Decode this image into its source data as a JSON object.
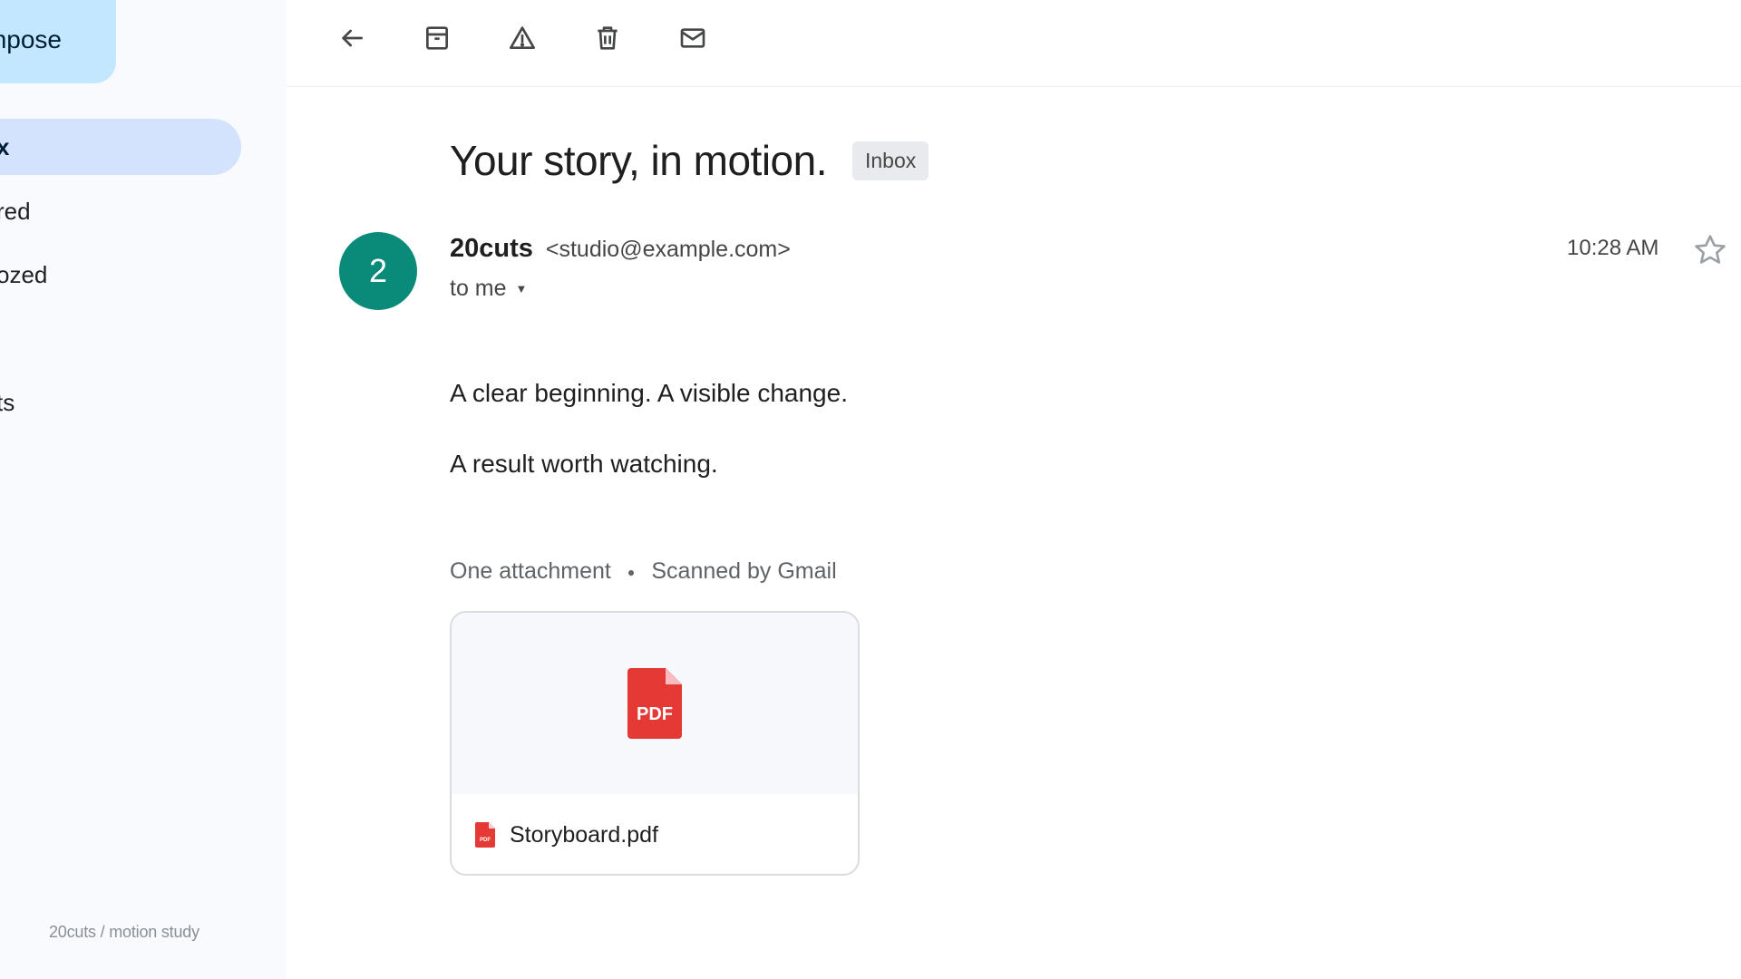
{
  "sidebar": {
    "compose_label": "mpose",
    "items": [
      {
        "label": "x",
        "active": true
      },
      {
        "label": "red",
        "active": false
      },
      {
        "label": "ozed",
        "active": false
      },
      {
        "label": "ts",
        "active": false
      }
    ],
    "footer": "20cuts / motion study"
  },
  "toolbar": {
    "icons": [
      "back-arrow-icon",
      "archive-icon",
      "report-spam-icon",
      "delete-icon",
      "mark-unread-icon"
    ]
  },
  "message": {
    "subject": "Your story, in motion.",
    "label": "Inbox",
    "avatar_initial": "2",
    "avatar_color": "#0a8a78",
    "sender_name": "20cuts",
    "sender_email": "<studio@example.com>",
    "recipient": "to me",
    "time": "10:28 AM",
    "body": [
      "A clear beginning. A visible change.",
      "A result worth watching."
    ]
  },
  "attachments": {
    "count_text": "One attachment",
    "scan_text": "Scanned by Gmail",
    "files": [
      {
        "name": "Storyboard.pdf",
        "type_label": "PDF",
        "icon_small_label": "PDF"
      }
    ]
  },
  "colors": {
    "accent_compose": "#c2e7ff",
    "accent_active_nav": "#d3e3fd",
    "pdf_red": "#e53935"
  }
}
